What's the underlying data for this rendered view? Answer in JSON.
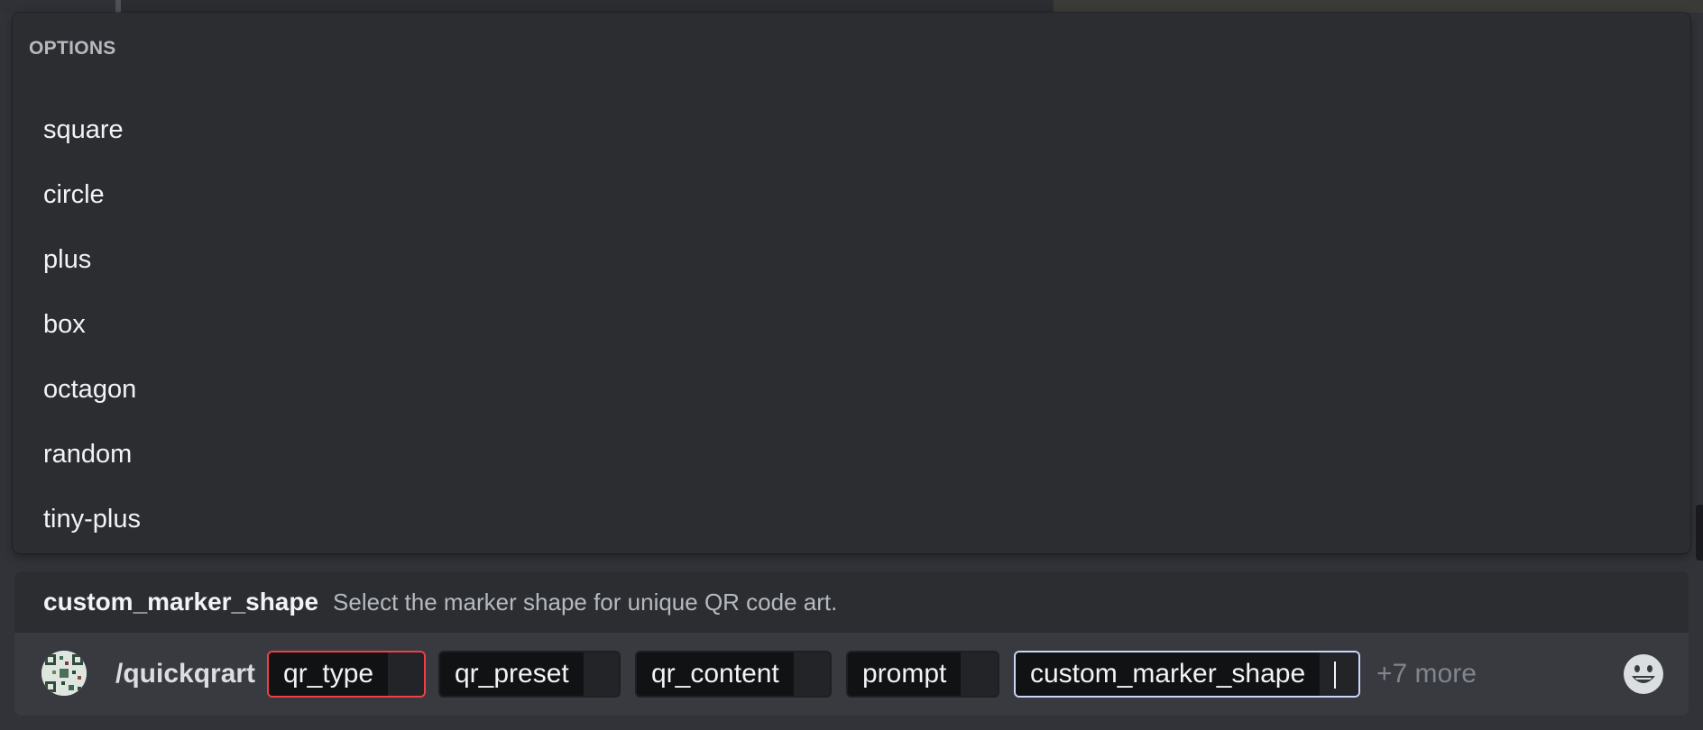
{
  "options_popup": {
    "header": "OPTIONS",
    "items": [
      "square",
      "circle",
      "plus",
      "box",
      "octagon",
      "random",
      "tiny-plus"
    ]
  },
  "description_bar": {
    "option_name": "custom_marker_shape",
    "description": "Select the marker shape for unique QR code art."
  },
  "command_bar": {
    "command": "/quickqrart",
    "params": {
      "qr_type": "qr_type",
      "qr_preset": "qr_preset",
      "qr_content": "qr_content",
      "prompt": "prompt",
      "custom_marker_shape": "custom_marker_shape"
    },
    "more": "+7 more"
  },
  "icons": {
    "avatar": "qr-art-avatar",
    "emoji": "smiley-face-icon"
  },
  "colors": {
    "popup_bg": "#2b2d31",
    "input_bg": "#383a40",
    "error_border": "#f23f43",
    "active_border": "#c9d7f8"
  }
}
